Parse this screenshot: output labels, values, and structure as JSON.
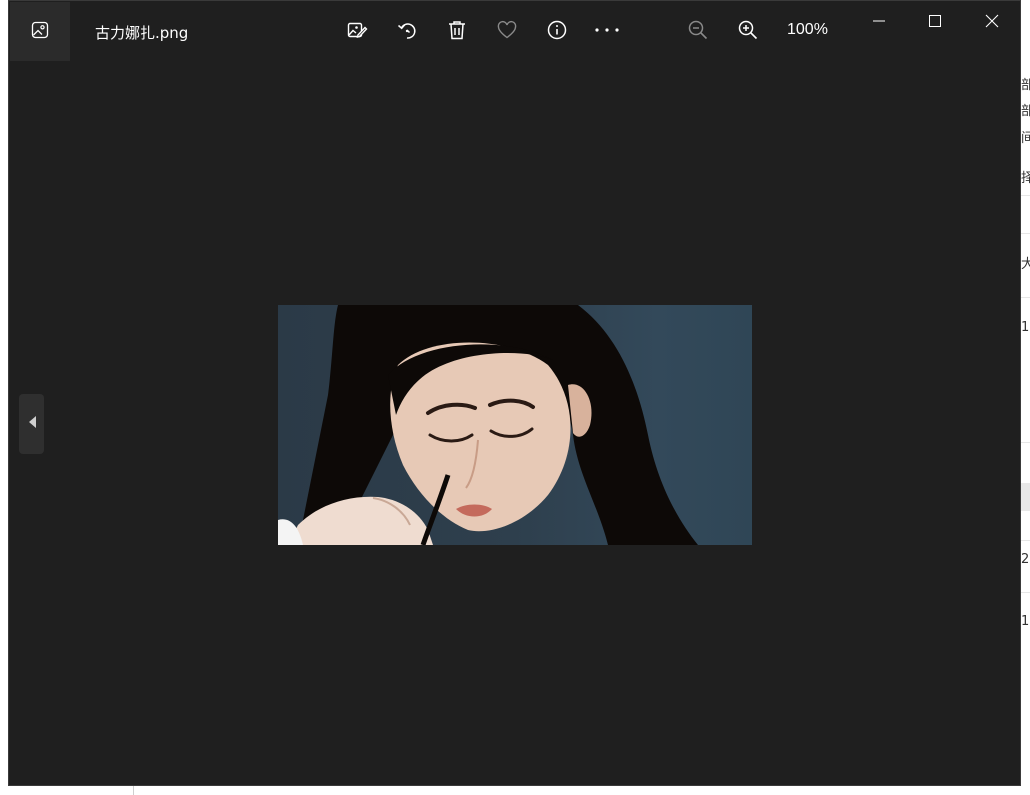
{
  "window": {
    "title": "古力娜扎.png",
    "zoom_level": "100%"
  },
  "toolbar": {
    "buttons": [
      {
        "name": "edit-image",
        "icon": "edit-image-icon"
      },
      {
        "name": "rotate",
        "icon": "rotate-icon"
      },
      {
        "name": "delete",
        "icon": "trash-icon"
      },
      {
        "name": "favorite",
        "icon": "heart-icon"
      },
      {
        "name": "info",
        "icon": "info-icon"
      },
      {
        "name": "more",
        "icon": "more-icon"
      },
      {
        "name": "zoom-out",
        "icon": "zoom-out-icon"
      },
      {
        "name": "zoom-in",
        "icon": "zoom-in-icon"
      }
    ]
  },
  "window_controls": [
    "minimize",
    "maximize",
    "close"
  ],
  "navigation": {
    "previous": "chevron-left-icon"
  },
  "background_window": {
    "visible_fragments": [
      "部",
      "部",
      "间",
      "择",
      "大",
      "1",
      "2",
      "1"
    ]
  },
  "colors": {
    "viewer_background": "#1f1f1f",
    "toolbar_icon": "#ffffff",
    "disabled_icon": "#8a8a8a"
  }
}
